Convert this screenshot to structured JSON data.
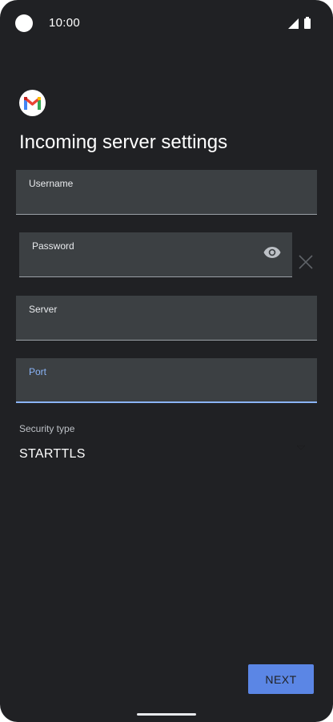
{
  "status_bar": {
    "time": "10:00"
  },
  "page": {
    "title": "Incoming server settings"
  },
  "form": {
    "username": {
      "label": "Username",
      "value": ""
    },
    "password": {
      "label": "Password",
      "value": ""
    },
    "server": {
      "label": "Server",
      "value": ""
    },
    "port": {
      "label": "Port",
      "value": ""
    },
    "security": {
      "label": "Security type",
      "value": "STARTTLS"
    }
  },
  "actions": {
    "next_label": "NEXT"
  },
  "icons": [
    "gmail-logo",
    "visibility-eye-icon",
    "clear-icon",
    "dropdown-arrow-icon",
    "signal-icon",
    "battery-icon"
  ],
  "colors": {
    "background": "#202124",
    "field": "#3c4043",
    "accent": "#8ab4f8",
    "button": "#5b86e5"
  }
}
